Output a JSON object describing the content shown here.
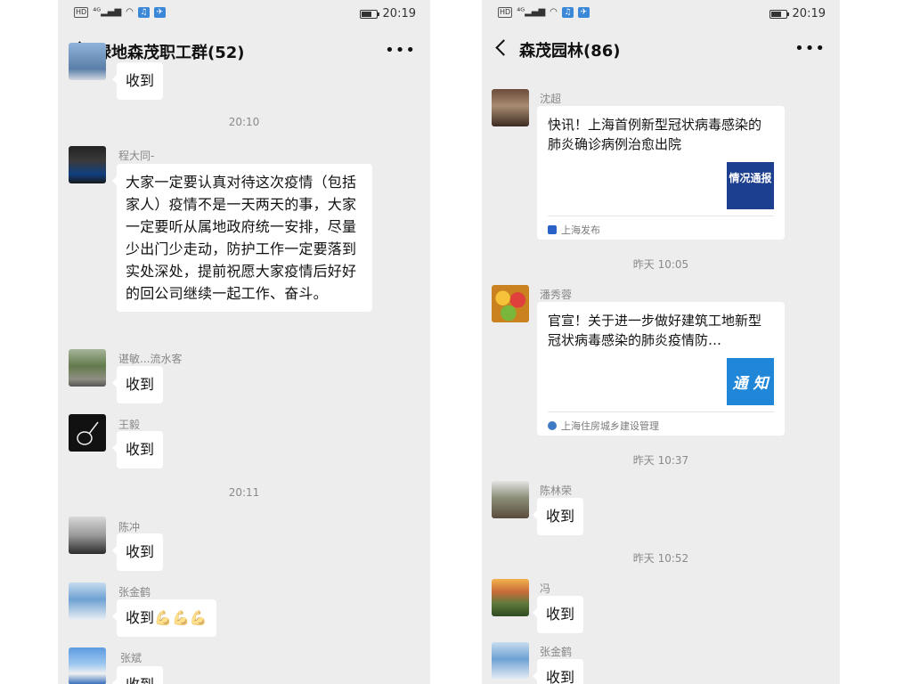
{
  "left": {
    "status_time": "20:19",
    "title": "绿地森茂职工群(52)",
    "messages": [
      {
        "text": "收到"
      },
      {
        "timestamp": "20:10"
      },
      {
        "sender": "程大同-",
        "text": "大家一定要认真对待这次疫情（包括家人）疫情不是一天两天的事，大家一定要听从属地政府统一安排，尽量少出门少走动，防护工作一定要落到实处深处，提前祝愿大家疫情后好好的回公司继续一起工作、奋斗。"
      },
      {
        "sender": "谌敏...流水客",
        "text": "收到"
      },
      {
        "sender": "王毅",
        "text": "收到"
      },
      {
        "timestamp": "20:11"
      },
      {
        "sender": "陈冲",
        "text": "收到"
      },
      {
        "sender": "张金鹤",
        "text": "收到",
        "emoji": "💪💪💪"
      },
      {
        "sender": "张斌",
        "text": "收到"
      }
    ]
  },
  "right": {
    "status_time": "20:19",
    "title": "森茂园林(86)",
    "messages": [
      {
        "sender": "沈超",
        "card_title": "快讯！上海首例新型冠状病毒感染的肺炎确诊病例治愈出院",
        "thumb": "情况通报",
        "source": "上海发布"
      },
      {
        "timestamp": "昨天 10:05"
      },
      {
        "sender": "潘秀蓉",
        "card_title": "官宣！关于进一步做好建筑工地新型冠状病毒感染的肺炎疫情防…",
        "thumb": "通 知",
        "source": "上海住房城乡建设管理"
      },
      {
        "timestamp": "昨天 10:37"
      },
      {
        "sender": "陈林荣",
        "text": "收到"
      },
      {
        "timestamp": "昨天 10:52"
      },
      {
        "sender": "冯",
        "text": "收到"
      },
      {
        "sender": "张金鹤",
        "text": "收到"
      }
    ]
  },
  "colors": {
    "chat_bg": "#ededed",
    "bubble_bg": "#ffffff",
    "thumb_blue_dark": "#1d3f8f",
    "thumb_blue": "#1f86d8"
  }
}
